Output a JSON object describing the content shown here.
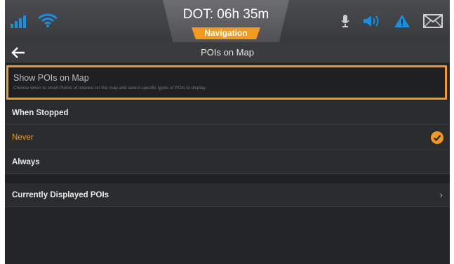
{
  "status": {
    "dot_text": "DOT: 06h 35m",
    "nav_badge": "Navigation",
    "icons": [
      "signal-icon",
      "wifi-icon",
      "microphone-icon",
      "volume-icon",
      "warning-icon",
      "mail-icon"
    ],
    "accent": "#f39a1e",
    "icon_blue": "#1a8fe0"
  },
  "header": {
    "title": "POIs on Map"
  },
  "show_pois": {
    "title": "Show POIs on Map",
    "description": "Choose when to show Points of Interest on the map and select specific types of POIs to display."
  },
  "options": [
    {
      "label": "When Stopped",
      "selected": false
    },
    {
      "label": "Never",
      "selected": true
    },
    {
      "label": "Always",
      "selected": false
    }
  ],
  "displayed": {
    "label": "Currently Displayed POIs"
  }
}
